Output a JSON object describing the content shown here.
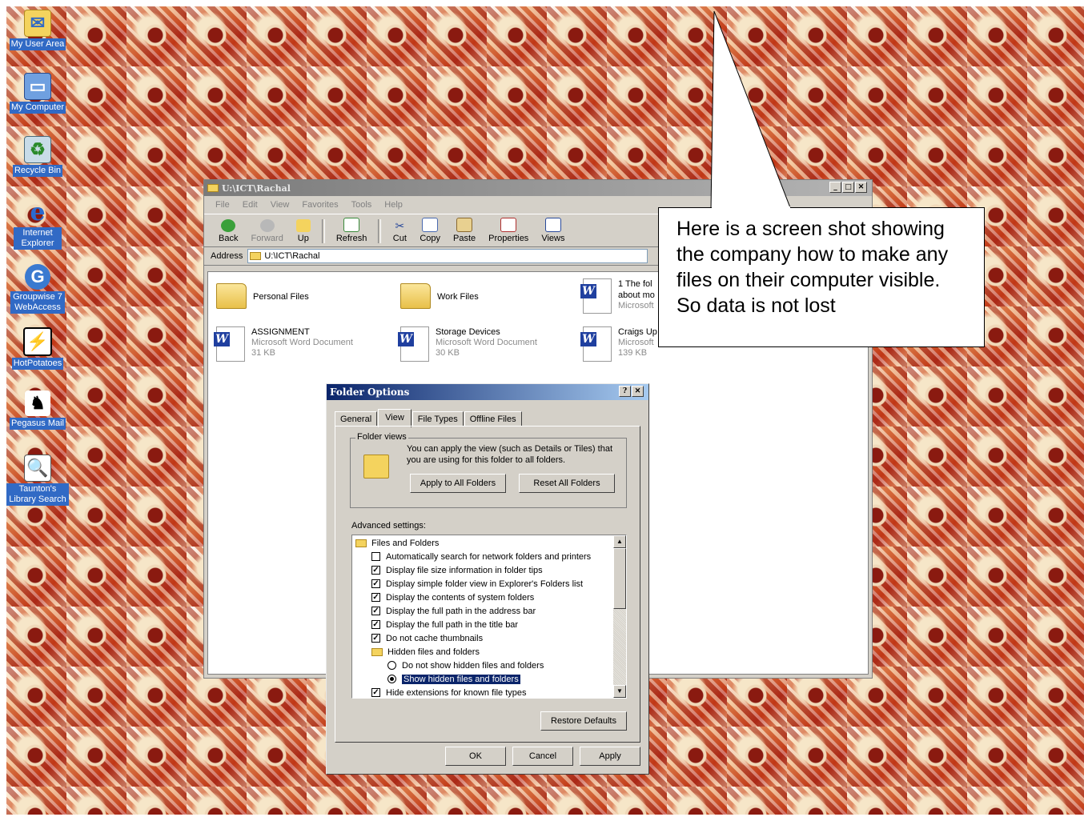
{
  "desktop": {
    "icons": [
      {
        "label": "My User Area",
        "icon": "folder-envelope-icon"
      },
      {
        "label": "My Computer",
        "icon": "computer-icon"
      },
      {
        "label": "Recycle Bin",
        "icon": "recycle-bin-icon"
      },
      {
        "label": "Internet Explorer",
        "icon": "internet-explorer-icon"
      },
      {
        "label": "Groupwise 7 WebAccess",
        "icon": "groupwise-icon"
      },
      {
        "label": "HotPotatoes",
        "icon": "hotpotatoes-icon"
      },
      {
        "label": "Pegasus Mail",
        "icon": "pegasus-icon"
      },
      {
        "label": "Taunton's Library Search",
        "icon": "library-search-icon"
      }
    ]
  },
  "explorer": {
    "title": "U:\\ICT\\Rachal",
    "menu": [
      "File",
      "Edit",
      "View",
      "Favorites",
      "Tools",
      "Help"
    ],
    "toolbar": {
      "back": "Back",
      "forward": "Forward",
      "up": "Up",
      "refresh": "Refresh",
      "cut": "Cut",
      "copy": "Copy",
      "paste": "Paste",
      "properties": "Properties",
      "views": "Views"
    },
    "address_label": "Address",
    "address_value": "U:\\ICT\\Rachal",
    "files": [
      {
        "name": "Personal Files",
        "type": "",
        "size": ""
      },
      {
        "name": "Work Files",
        "type": "",
        "size": ""
      },
      {
        "name": "1 The fol",
        "line2": "about mo",
        "type": "Microsoft",
        "size": ""
      },
      {
        "name": "ASSIGNMENT",
        "type": "Microsoft Word Document",
        "size": "31 KB"
      },
      {
        "name": "Storage Devices",
        "type": "Microsoft Word Document",
        "size": "30 KB"
      },
      {
        "name": "Craigs Up",
        "type": "Microsoft",
        "size": "139 KB"
      }
    ]
  },
  "dialog": {
    "title": "Folder Options",
    "help_btn": "?",
    "close_btn": "✕",
    "tabs": [
      "General",
      "View",
      "File Types",
      "Offline Files"
    ],
    "folder_views": {
      "legend": "Folder views",
      "text": "You can apply the view (such as Details or Tiles) that you are using for this folder to all folders.",
      "apply_btn": "Apply to All Folders",
      "reset_btn": "Reset All Folders"
    },
    "advanced_label": "Advanced settings:",
    "settings": [
      {
        "kind": "folder",
        "label": "Files and Folders",
        "level": 0
      },
      {
        "kind": "checkbox",
        "checked": false,
        "label": "Automatically search for network folders and printers",
        "level": 1
      },
      {
        "kind": "checkbox",
        "checked": true,
        "label": "Display file size information in folder tips",
        "level": 1
      },
      {
        "kind": "checkbox",
        "checked": true,
        "label": "Display simple folder view in Explorer's Folders list",
        "level": 1
      },
      {
        "kind": "checkbox",
        "checked": true,
        "label": "Display the contents of system folders",
        "level": 1
      },
      {
        "kind": "checkbox",
        "checked": true,
        "label": "Display the full path in the address bar",
        "level": 1
      },
      {
        "kind": "checkbox",
        "checked": true,
        "label": "Display the full path in the title bar",
        "level": 1
      },
      {
        "kind": "checkbox",
        "checked": true,
        "label": "Do not cache thumbnails",
        "level": 1
      },
      {
        "kind": "folder",
        "label": "Hidden files and folders",
        "level": 1
      },
      {
        "kind": "radio",
        "checked": false,
        "label": "Do not show hidden files and folders",
        "level": 2
      },
      {
        "kind": "radio",
        "checked": true,
        "selected": true,
        "label": "Show hidden files and folders",
        "level": 2
      },
      {
        "kind": "checkbox",
        "checked": true,
        "label": "Hide extensions for known file types",
        "level": 1
      }
    ],
    "restore_defaults": "Restore Defaults",
    "ok": "OK",
    "cancel": "Cancel",
    "apply": "Apply"
  },
  "callout": {
    "text": "Here is a screen shot showing the company how to make any files on their computer visible. So data is not lost"
  },
  "colors": {
    "dialog_title": "#0a246a",
    "selection": "#0a246a",
    "icon_label_bg": "#316ac5"
  }
}
